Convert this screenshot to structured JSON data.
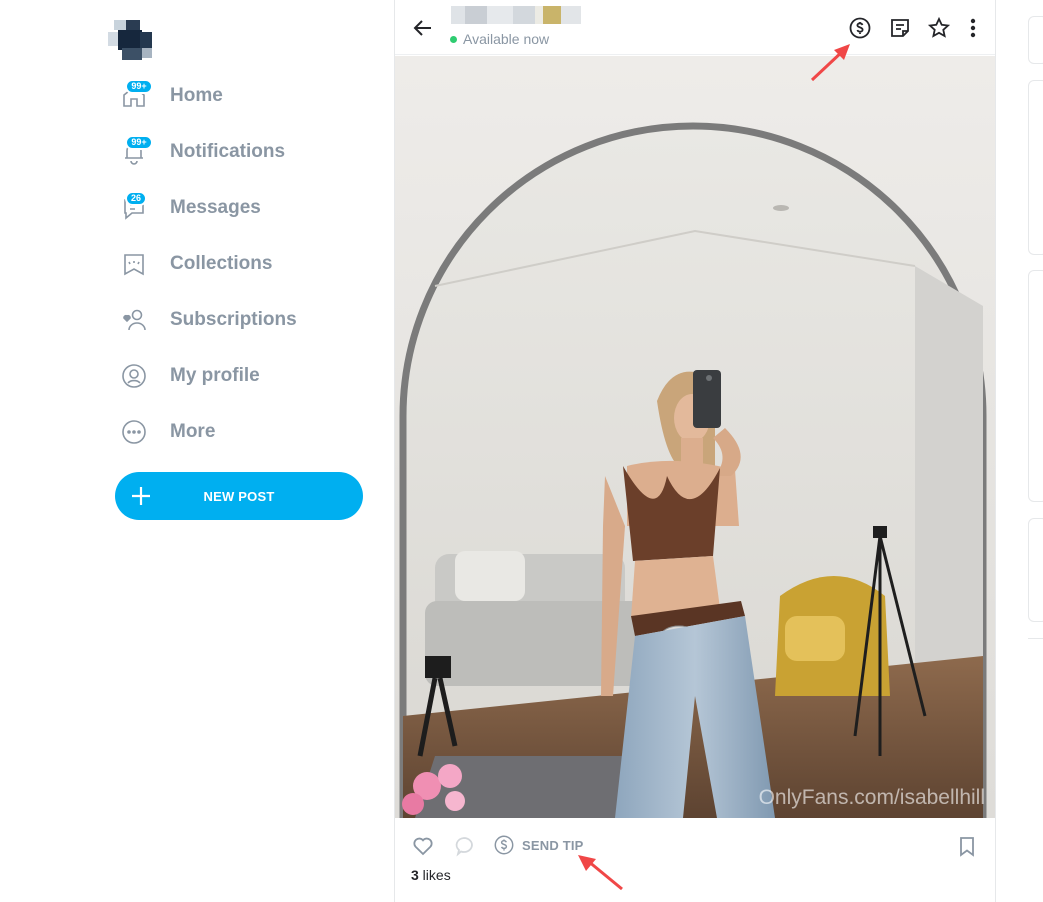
{
  "sidebar": {
    "nav": [
      {
        "label": "Home",
        "icon": "home-icon",
        "badge": "99+"
      },
      {
        "label": "Notifications",
        "icon": "bell-icon",
        "badge": "99+"
      },
      {
        "label": "Messages",
        "icon": "chat-icon",
        "badge": "26"
      },
      {
        "label": "Collections",
        "icon": "bookmark-stars-icon",
        "badge": null
      },
      {
        "label": "Subscriptions",
        "icon": "user-heart-icon",
        "badge": null
      },
      {
        "label": "My profile",
        "icon": "profile-circle-icon",
        "badge": null
      },
      {
        "label": "More",
        "icon": "more-circle-icon",
        "badge": null
      }
    ],
    "new_post_label": "NEW POST"
  },
  "header": {
    "status": "Available now",
    "icons": [
      "back-arrow-icon",
      "dollar-circle-icon",
      "note-icon",
      "star-icon",
      "kebab-menu-icon"
    ]
  },
  "post": {
    "watermark": "OnlyFans.com/isabellhill",
    "send_tip_label": "SEND TIP",
    "likes_count": "3",
    "likes_suffix": " likes"
  },
  "colors": {
    "accent": "#00aff0",
    "muted_text": "#8a96a3",
    "online": "#2ecc71",
    "annotation_arrow": "#f04747"
  }
}
